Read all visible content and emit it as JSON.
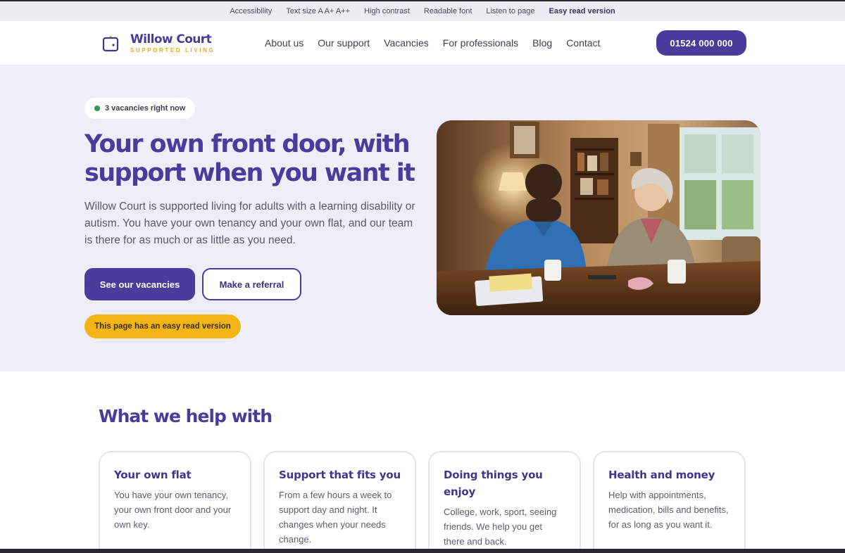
{
  "accessibility_bar": {
    "items": [
      "Accessibility",
      "Text size A A+ A++",
      "High contrast",
      "Readable font",
      "Listen to page",
      "Easy read version"
    ]
  },
  "header": {
    "logo_name": "Willow Court",
    "logo_sub": "SUPPORTED LIVING",
    "nav": [
      "About us",
      "Our support",
      "Vacancies",
      "For professionals",
      "Blog",
      "Contact"
    ],
    "phone": "01524 000 000"
  },
  "hero": {
    "badge": "3 vacancies right now",
    "title": "Your own front door, with support when you want it",
    "body": "Willow Court is supported living for adults with a learning disability or autism. You have your own tenancy and your own flat, and our team is there for as much or as little as you need.",
    "primary_button": "See our vacancies",
    "secondary_button": "Make a referral",
    "easy_read_pill": "This page has an easy read version"
  },
  "help": {
    "title": "What we help with",
    "cards": [
      {
        "title": "Your own flat",
        "text": "You have your own tenancy, your own front door and your own key."
      },
      {
        "title": "Support that fits you",
        "text": "From a few hours a week to support day and night. It changes when your needs change."
      },
      {
        "title": "Doing things you enjoy",
        "text": "College, work, sport, seeing friends. We help you get there and back."
      },
      {
        "title": "Health and money",
        "text": "Help with appointments, medication, bills and benefits, for as long as you want it."
      }
    ]
  },
  "colors": {
    "brand_purple": "#4b3b9c",
    "accent_yellow": "#f2b515",
    "hero_bg": "#efeef8",
    "status_green": "#2a9a4c"
  }
}
